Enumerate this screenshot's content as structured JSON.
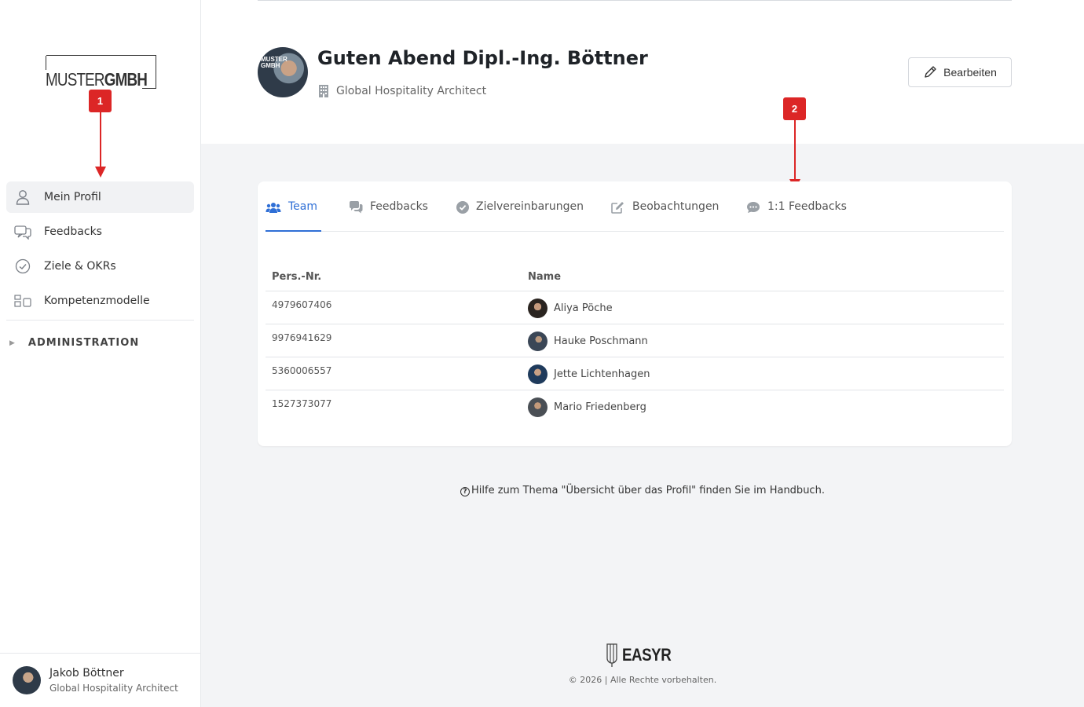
{
  "logo": {
    "part1": "MUSTER",
    "part2": "GMBH"
  },
  "annotations": {
    "first": "1",
    "second": "2"
  },
  "sidebar": {
    "items": [
      {
        "label": "Mein Profil",
        "icon": "user-icon",
        "active": true
      },
      {
        "label": "Feedbacks",
        "icon": "chat-icon"
      },
      {
        "label": "Ziele & OKRs",
        "icon": "check-circle-icon"
      },
      {
        "label": "Kompetenzmodelle",
        "icon": "grid-icon"
      }
    ],
    "admin_label": "ADMINISTRATION",
    "user": {
      "name": "Jakob Böttner",
      "role": "Global Hospitality Architect"
    }
  },
  "header": {
    "greeting": "Guten Abend Dipl.-Ing. Böttner",
    "role": "Global Hospitality Architect",
    "edit_label": "Bearbeiten",
    "avatar_text": "MUSTER GMBH"
  },
  "tabs": [
    {
      "label": "Team",
      "icon": "users-icon",
      "active": true
    },
    {
      "label": "Feedbacks",
      "icon": "comments-icon"
    },
    {
      "label": "Zielvereinbarungen",
      "icon": "check-circle-icon"
    },
    {
      "label": "Beobachtungen",
      "icon": "edit-icon"
    },
    {
      "label": "1:1 Feedbacks",
      "icon": "comment-dots-icon"
    }
  ],
  "table": {
    "headers": {
      "pers_nr": "Pers.-Nr.",
      "name": "Name"
    },
    "rows": [
      {
        "pers_nr": "4979607406",
        "name": "Aliya Pöche"
      },
      {
        "pers_nr": "9976941629",
        "name": "Hauke Poschmann"
      },
      {
        "pers_nr": "5360006557",
        "name": "Jette Lichtenhagen"
      },
      {
        "pers_nr": "1527373077",
        "name": "Mario Friedenberg"
      }
    ]
  },
  "help_text": "Hilfe zum Thema \"Übersicht über das Profil\" finden Sie im Handbuch.",
  "footer": {
    "brand": "EASYR",
    "copyright": "© 2026 | Alle Rechte vorbehalten."
  },
  "colors": {
    "accent": "#2f6fd6",
    "annotation": "#dc2626",
    "background": "#f3f4f6"
  }
}
